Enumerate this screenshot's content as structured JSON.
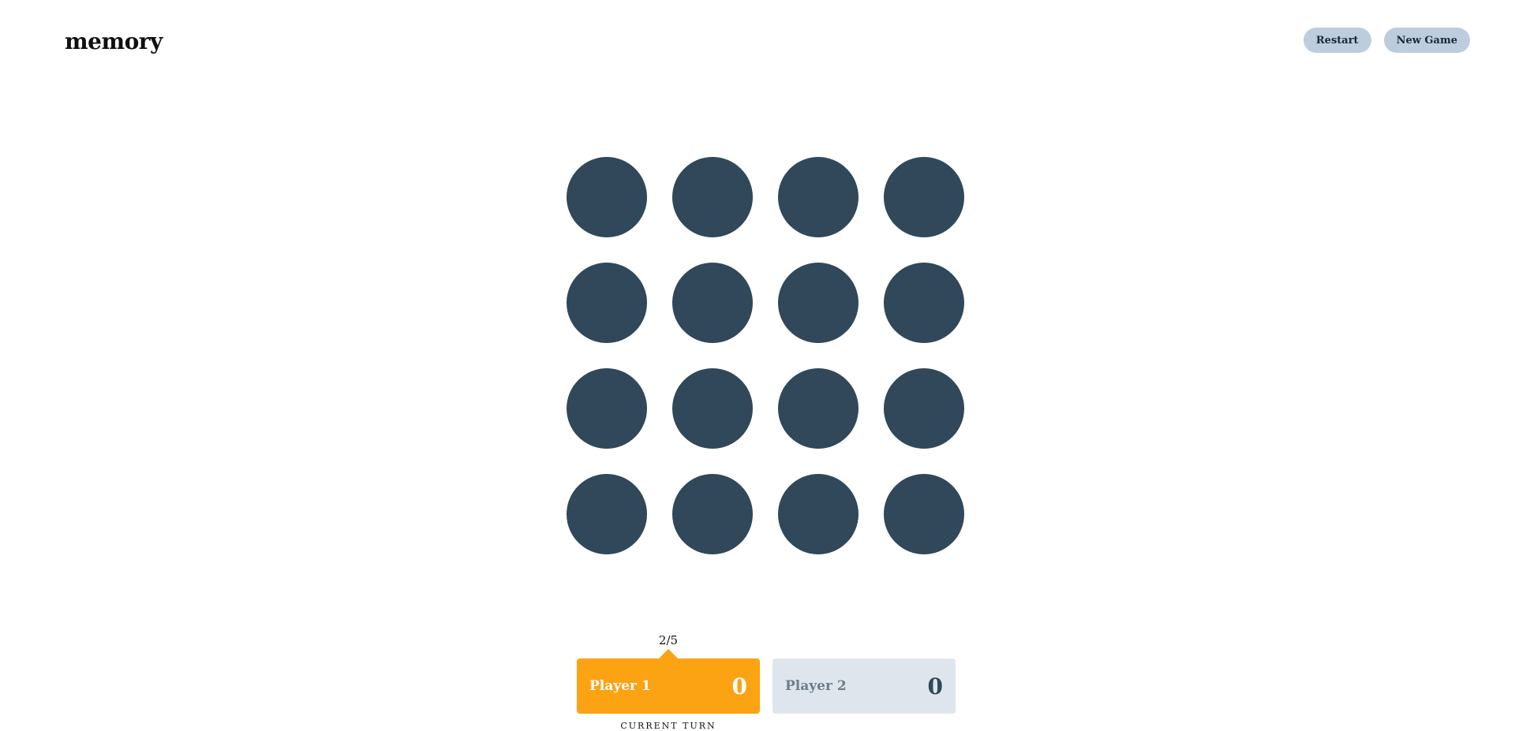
{
  "header": {
    "logo": "memory",
    "restart_label": "Restart",
    "new_game_label": "New Game"
  },
  "board": {
    "rows": 4,
    "cols": 4,
    "tile_count": 16,
    "tile_state": "hidden",
    "colors": {
      "tile_hidden": "#304859",
      "accent": "#fba313",
      "inactive_card": "#dfe5ec",
      "button": "#bccedd"
    }
  },
  "players": [
    {
      "name": "Player 1",
      "score": "0",
      "active": true,
      "turn_counter": "2/5",
      "turn_label": "CURRENT TURN"
    },
    {
      "name": "Player 2",
      "score": "0",
      "active": false
    }
  ]
}
